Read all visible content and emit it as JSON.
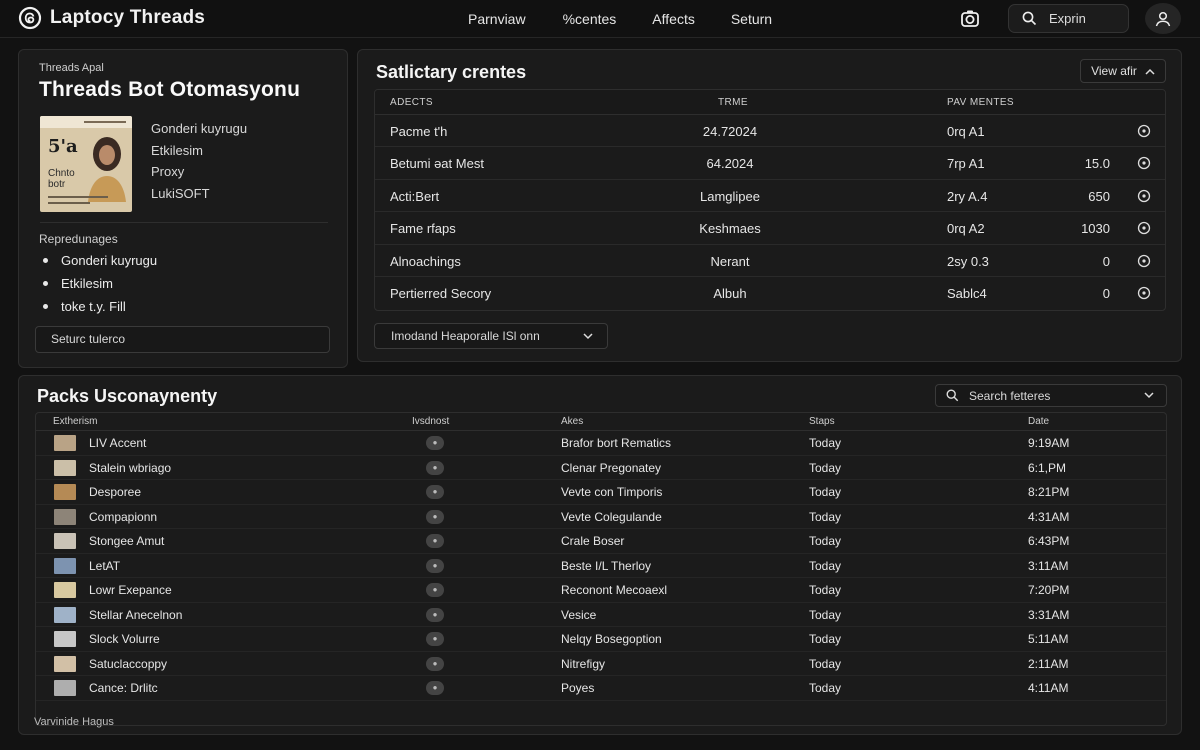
{
  "header": {
    "app_title": "Laptocy Threads",
    "nav": [
      "Parnviaw",
      "%centes",
      "Affects",
      "Seturn"
    ],
    "search_label": "Exprin",
    "icons": [
      "threads-logo-icon",
      "camera-icon",
      "search-icon",
      "user-icon"
    ]
  },
  "profile": {
    "kicker": "Threads Apal",
    "title": "Threads Bot Otomasyonu",
    "book_cover_text": "5'a",
    "book_cover_subtext": "Chnto botr",
    "meta": [
      "Gonderi kuyrugu",
      "Etkilesim",
      "Proxy",
      "LukiSOFT"
    ],
    "list_label": "Repredunages",
    "bullets": [
      "Gonderi kuyrugu",
      "Etkilesim",
      "toke t.y. Fill"
    ],
    "input_value": "Seturc tulerco"
  },
  "stats": {
    "title": "Satlictary crentes",
    "view_button": "View afir",
    "columns": [
      "ADECTS",
      "TRME",
      "PAV MENTES"
    ],
    "rows": [
      {
        "name": "Pacme t'h",
        "trme": "24.72024",
        "pav": "0rq A1",
        "value": ""
      },
      {
        "name": "Betumi ǝat Mest",
        "trme": "64.2024",
        "pav": "7rp A1",
        "value": "15.0"
      },
      {
        "name": "Acti:Bert",
        "trme": "Lamglipee",
        "pav": "2ry A.4",
        "value": "650"
      },
      {
        "name": "Fame rfaps",
        "trme": "Keshmaes",
        "pav": "0rq A2",
        "value": "1030"
      },
      {
        "name": "Alnoachings",
        "trme": "Nerant",
        "pav": "2sy 0.3",
        "value": "0"
      },
      {
        "name": "Pertierred Secory",
        "trme": "Albuh",
        "pav": "Sablc4",
        "value": "0"
      }
    ],
    "dropdown": "Imodand Heaporalle ISl onn"
  },
  "packs": {
    "title": "Packs Usconaynenty",
    "search_placeholder": "Search fetteres",
    "columns": [
      "Extherism",
      "Ivsdnost",
      "Akes",
      "Staps",
      "Date"
    ],
    "rows": [
      {
        "name": "LIV Accent",
        "akes": "Brafor bort Rematics",
        "staps": "Today",
        "date": "9:19AM",
        "thumb": "#b9a386"
      },
      {
        "name": "Stalein wbriago",
        "akes": "Clenar Pregonatey",
        "staps": "Today",
        "date": "6:1,PM",
        "thumb": "#cbbfa8"
      },
      {
        "name": "Desporee",
        "akes": "Vevte con Timporis",
        "staps": "Today",
        "date": "8:21PM",
        "thumb": "#b58a55"
      },
      {
        "name": "Compapionn",
        "akes": "Vevte Colegulande",
        "staps": "Today",
        "date": "4:31AM",
        "thumb": "#8d8478"
      },
      {
        "name": "Stongee Amut",
        "akes": "Crale Boser",
        "staps": "Today",
        "date": "6:43PM",
        "thumb": "#c9c2b6"
      },
      {
        "name": "LetAT",
        "akes": "Beste I/L Therloy",
        "staps": "Today",
        "date": "3:11AM",
        "thumb": "#7d93b0"
      },
      {
        "name": "Lowr Exepance",
        "akes": "Reconont Mecoaexl",
        "staps": "Today",
        "date": "7:20PM",
        "thumb": "#d8c9a0"
      },
      {
        "name": "Stellar Anecelnon",
        "akes": "Vesice",
        "staps": "Today",
        "date": "3:31AM",
        "thumb": "#9fb2c8"
      },
      {
        "name": "Slock Volurre",
        "akes": "Nelqy Bosegoption",
        "staps": "Today",
        "date": "5:11AM",
        "thumb": "#c7c7c7"
      },
      {
        "name": "Satuclaccoppy",
        "akes": "Nitrefigy",
        "staps": "Today",
        "date": "2:11AM",
        "thumb": "#d2c0a6"
      },
      {
        "name": "Cance: Drlitc",
        "akes": "Poyes",
        "staps": "Today",
        "date": "4:11AM",
        "thumb": "#aeaeae"
      }
    ],
    "footer": "Varvinide Hagus"
  }
}
